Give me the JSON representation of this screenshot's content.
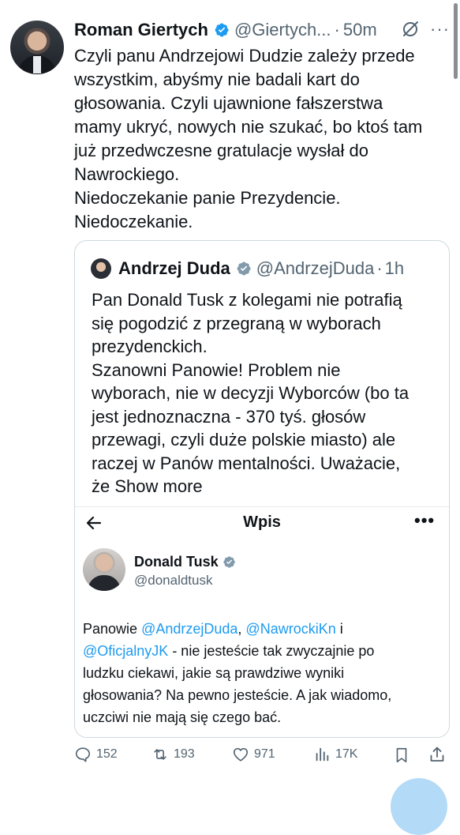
{
  "tweet": {
    "author_name": "Roman Giertych",
    "handle": "@Giertych...",
    "separator": "·",
    "time": "50m",
    "lines": [
      "Czyli panu Andrzejowi Dudzie zależy przede",
      "wszystkim, abyśmy nie badali kart do",
      "głosowania. Czyli ujawnione fałszerstwa",
      "mamy ukryć, nowych nie szukać, bo ktoś tam",
      "już przedwczesne gratulacje wysłał do",
      "Nawrockiego.",
      "Niedoczekanie panie Prezydencie.",
      "Niedoczekanie."
    ]
  },
  "quote": {
    "author_name": "Andrzej Duda",
    "handle": "@AndrzejDuda",
    "separator": "·",
    "time": "1h",
    "lines": [
      "Pan Donald Tusk z kolegami nie potrafią",
      "się pogodzić z przegraną w wyborach",
      "prezydenckich.",
      "Szanowni Panowie! Problem nie",
      "wyborach, nie w decyzji Wyborców (bo ta",
      "jest jednoznaczna - 370 tyś. głosów",
      "przewagi, czyli duże polskie miasto) ale",
      "raczej w Panów mentalności. Uważacie,"
    ],
    "last_line_prefix": "że",
    "show_more": "Show more"
  },
  "embed": {
    "title": "Wpis",
    "more": "•••",
    "author_name": "Donald Tusk",
    "handle": "@donaldtusk",
    "line1_prefix": "Panowie ",
    "mention1": "@AndrzejDuda",
    "line1_mid": ", ",
    "mention2": "@NawrockiKn",
    "line1_suffix": " i",
    "mention3": "@OficjalnyJK",
    "line2_suffix": " - nie jesteście tak zwyczajnie po",
    "line3": "ludzku ciekawi, jakie są prawdziwe wyniki",
    "line4": "głosowania? Na pewno jesteście. A jak wiadomo,",
    "line5": "uczciwi nie mają się czego bać."
  },
  "actions": {
    "replies": "152",
    "reposts": "193",
    "likes": "971",
    "views": "17K"
  },
  "more_menu": "···",
  "colors": {
    "text": "#0f1419",
    "secondary": "#536471",
    "verified": "#1d9bf0",
    "mention": "#1d9bf0",
    "border": "#cfd9de"
  }
}
